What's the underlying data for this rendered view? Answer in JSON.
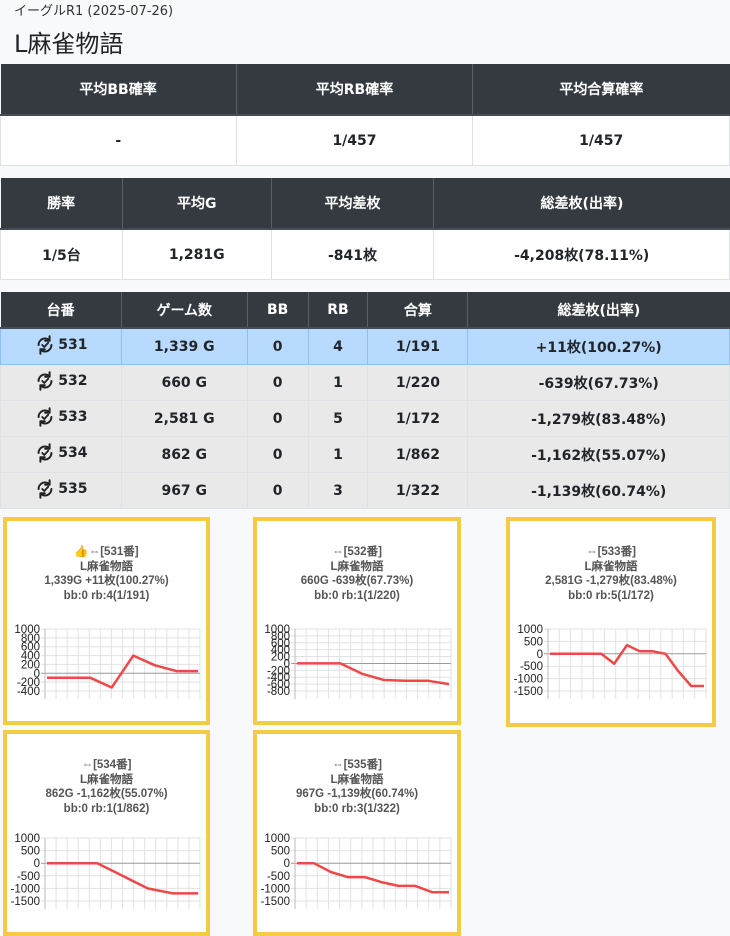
{
  "header": {
    "subtitle": "イーグルR1 (2025-07-26)",
    "title": "L麻雀物語"
  },
  "summary1": {
    "headers": [
      "平均BB確率",
      "平均RB確率",
      "平均合算確率"
    ],
    "values": [
      "-",
      "1/457",
      "1/457"
    ]
  },
  "summary2": {
    "headers": [
      "勝率",
      "平均G",
      "平均差枚",
      "総差枚(出率)"
    ],
    "values": [
      "1/5台",
      "1,281G",
      "-841枚",
      "-4,208枚(78.11%)"
    ]
  },
  "machines": {
    "headers": [
      "台番",
      "ゲーム数",
      "BB",
      "RB",
      "合算",
      "総差枚(出率)"
    ],
    "rows": [
      {
        "no": "531",
        "games": "1,339 G",
        "bb": "0",
        "rb": "4",
        "combined": "1/191",
        "diff": "+11枚(100.27%)",
        "highlight": true
      },
      {
        "no": "532",
        "games": "660 G",
        "bb": "0",
        "rb": "1",
        "combined": "1/220",
        "diff": "-639枚(67.73%)",
        "highlight": false
      },
      {
        "no": "533",
        "games": "2,581 G",
        "bb": "0",
        "rb": "5",
        "combined": "1/172",
        "diff": "-1,279枚(83.48%)",
        "highlight": false
      },
      {
        "no": "534",
        "games": "862 G",
        "bb": "0",
        "rb": "1",
        "combined": "1/862",
        "diff": "-1,162枚(55.07%)",
        "highlight": false
      },
      {
        "no": "535",
        "games": "967 G",
        "bb": "0",
        "rb": "3",
        "combined": "1/322",
        "diff": "-1,139枚(60.74%)",
        "highlight": false
      }
    ]
  },
  "cards": [
    {
      "line1": "👍⇔[531番]",
      "line2": "L麻雀物語",
      "line3": "1,339G +11枚(100.27%)",
      "line4": "bb:0 rb:4(1/191)"
    },
    {
      "line1": "⇔[532番]",
      "line2": "L麻雀物語",
      "line3": "660G -639枚(67.73%)",
      "line4": "bb:0 rb:1(1/220)"
    },
    {
      "line1": "⇔[533番]",
      "line2": "L麻雀物語",
      "line3": "2,581G -1,279枚(83.48%)",
      "line4": "bb:0 rb:5(1/172)"
    },
    {
      "line1": "⇔[534番]",
      "line2": "L麻雀物語",
      "line3": "862G -1,162枚(55.07%)",
      "line4": "bb:0 rb:1(1/862)"
    },
    {
      "line1": "⇔[535番]",
      "line2": "L麻雀物語",
      "line3": "967G -1,139枚(60.74%)",
      "line4": "bb:0 rb:3(1/322)"
    }
  ],
  "chart_data": [
    {
      "type": "line",
      "color": "#f04848",
      "yticks": [
        "1000",
        "800",
        "600",
        "400",
        "200",
        "0",
        "-200",
        "-400"
      ],
      "ylim": [
        -400,
        1000
      ],
      "values": [
        -100,
        -100,
        -100,
        -320,
        400,
        180,
        50,
        50
      ]
    },
    {
      "type": "line",
      "color": "#f04848",
      "yticks": [
        "1000",
        "800",
        "600",
        "400",
        "200",
        "0",
        "-200",
        "-400",
        "-600",
        "-800"
      ],
      "ylim": [
        -800,
        1000
      ],
      "values": [
        0,
        0,
        0,
        -300,
        -480,
        -500,
        -500,
        -600
      ]
    },
    {
      "type": "line",
      "color": "#f04848",
      "yticks": [
        "1000",
        "500",
        "0",
        "-500",
        "-1000",
        "-1500"
      ],
      "ylim": [
        -1500,
        1000
      ],
      "values": [
        0,
        0,
        0,
        0,
        0,
        -400,
        350,
        100,
        100,
        0,
        -700,
        -1300,
        -1300
      ]
    },
    {
      "type": "line",
      "color": "#f04848",
      "yticks": [
        "1000",
        "500",
        "0",
        "-500",
        "-1000",
        "-1500"
      ],
      "ylim": [
        -1500,
        1000
      ],
      "values": [
        0,
        0,
        0,
        -500,
        -1000,
        -1200,
        -1200
      ]
    },
    {
      "type": "line",
      "color": "#f04848",
      "yticks": [
        "1000",
        "500",
        "0",
        "-500",
        "-1000",
        "-1500"
      ],
      "ylim": [
        -1500,
        1000
      ],
      "values": [
        0,
        0,
        -350,
        -550,
        -550,
        -750,
        -900,
        -900,
        -1150,
        -1150
      ]
    }
  ]
}
